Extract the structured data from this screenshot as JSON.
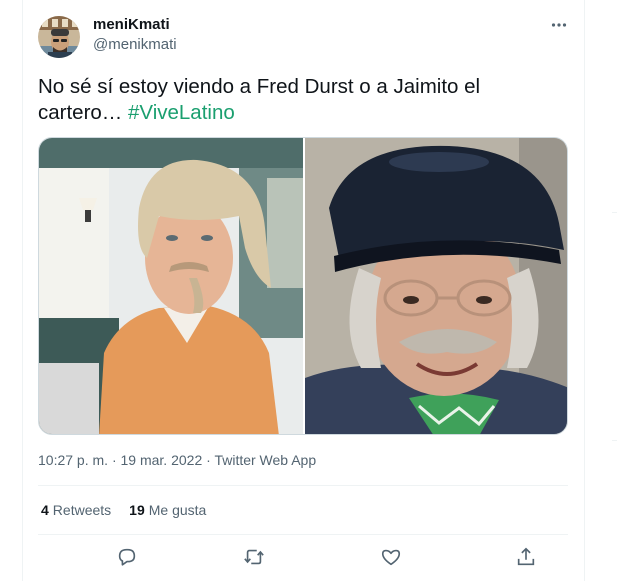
{
  "tweet": {
    "author_name": "meniKmati",
    "author_handle": "@menikmati",
    "text_plain": "No sé sí estoy viendo a Fred Durst o a Jaimito el cartero… ",
    "hashtag": "#ViveLatino",
    "time": "10:27 p. m.",
    "date": "19 mar. 2022",
    "source": "Twitter Web App",
    "separator": "·",
    "retweets_count": "4",
    "retweets_label": "Retweets",
    "likes_count": "19",
    "likes_label": "Me gusta"
  },
  "icons": {
    "more": "more-dots-icon",
    "reply": "reply-icon",
    "retweet": "retweet-icon",
    "like": "like-icon",
    "share": "share-icon"
  },
  "colors": {
    "hashtag": "#1a9f6f",
    "secondary_text": "#536471",
    "divider": "#eff3f4"
  }
}
